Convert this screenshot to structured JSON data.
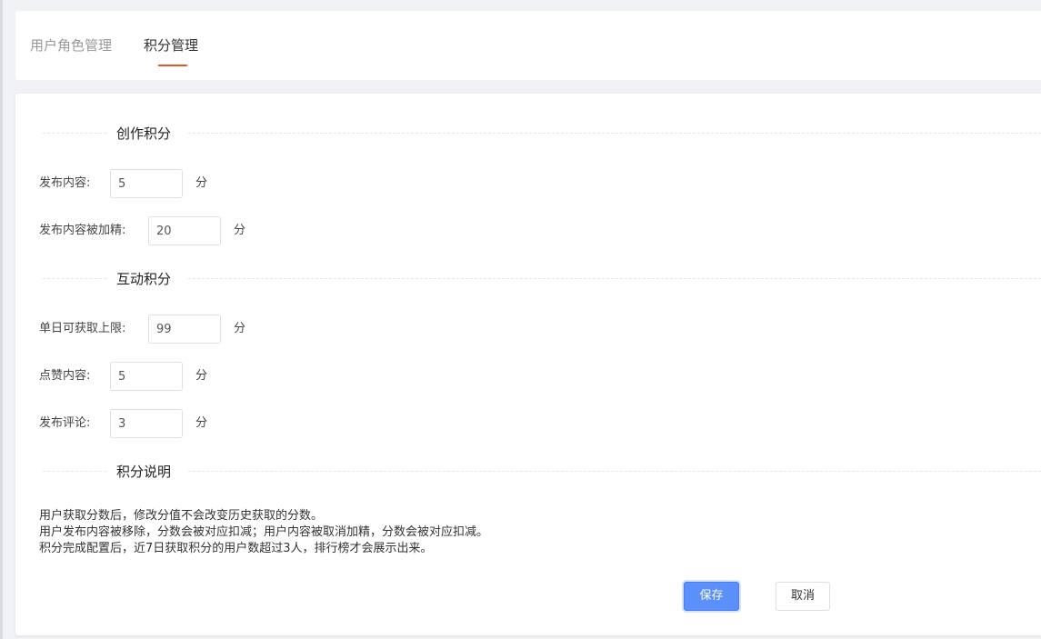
{
  "tabs": [
    {
      "label": "用户角色管理",
      "active": false
    },
    {
      "label": "积分管理",
      "active": true
    }
  ],
  "sections": {
    "creation": {
      "title": "创作积分",
      "fields": [
        {
          "label": "发布内容:",
          "value": "5",
          "unit": "分"
        },
        {
          "label": "发布内容被加精:",
          "value": "20",
          "unit": "分"
        }
      ]
    },
    "interaction": {
      "title": "互动积分",
      "fields": [
        {
          "label": "单日可获取上限:",
          "value": "99",
          "unit": "分"
        },
        {
          "label": "点赞内容:",
          "value": "5",
          "unit": "分"
        },
        {
          "label": "发布评论:",
          "value": "3",
          "unit": "分"
        }
      ]
    },
    "explanation": {
      "title": "积分说明",
      "lines": [
        "用户获取分数后，修改分值不会改变历史获取的分数。",
        "用户发布内容被移除，分数会被对应扣减；用户内容被取消加精，分数会被对应扣减。",
        "积分完成配置后，近7日获取积分的用户数超过3人，排行榜才会展示出来。"
      ]
    }
  },
  "actions": {
    "save_label": "保存",
    "cancel_label": "取消"
  },
  "colors": {
    "accent": "#e4572e",
    "primary_button": "#5b8ff9"
  }
}
